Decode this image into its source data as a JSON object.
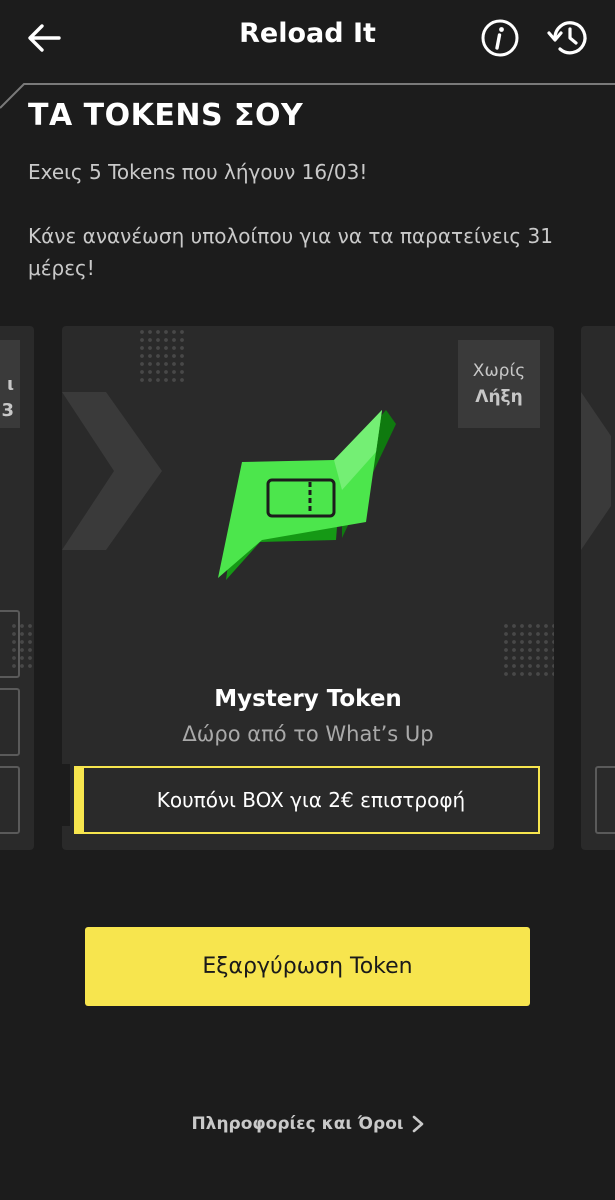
{
  "header": {
    "title": "Reload It",
    "back_icon": "arrow-left-icon",
    "info_icon": "info-circle-icon",
    "history_icon": "history-icon"
  },
  "main": {
    "section_title": "ΤΑ TOKENS ΣΟΥ",
    "expiry_text": "Exeις 5 Tokens που λήγουν 16/03!",
    "renew_text": "Κάνε ανανέωση υπολοίπου για να τα παρατείνεις 31 μέρες!"
  },
  "carousel": {
    "left_card": {
      "badge_line1": "ι",
      "badge_line2": "3"
    },
    "main_card": {
      "badge_line1": "Χωρίς",
      "badge_line2": "Λήξη",
      "token_name": "Mystery Token",
      "token_subtitle": "Δώρο από το What’s Up",
      "coupon_text": "Κουπόνι BOX για 2€ επιστροφή",
      "token_icon": "ticket-flag-icon"
    }
  },
  "actions": {
    "redeem_label": "Εξαργύρωση Token",
    "terms_label": "Πληροφορίες και Όροι"
  },
  "colors": {
    "background": "#1c1c1c",
    "card": "#2a2a2a",
    "accent_yellow": "#f7e54e",
    "token_green": "#4ce64c"
  }
}
